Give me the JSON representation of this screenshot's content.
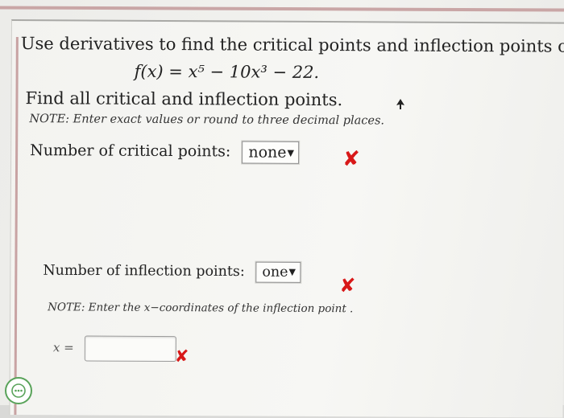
{
  "question": {
    "intro": "Use derivatives to find the critical points and inflection points of",
    "formula": "f(x) = x⁵ − 10x³ − 22.",
    "instruction": "Find all critical and inflection points.",
    "note": "NOTE: Enter exact values or round to three decimal places."
  },
  "critical_points": {
    "label": "Number of critical points:",
    "selected": "none",
    "status": "✘"
  },
  "inflection_points": {
    "label": "Number of inflection points:",
    "selected": "one",
    "status": "✘",
    "note": "NOTE: Enter the x−coordinates of the inflection point .",
    "answer_label": "x =",
    "answer_value": "",
    "answer_status": "✘"
  },
  "icons": [
    "pointer-cursor-icon",
    "help-chat-icon",
    "dropdown-arrow-icon",
    "incorrect-x-icon"
  ],
  "colors": {
    "incorrect": "#d81818",
    "help_ring": "#59a35a"
  }
}
